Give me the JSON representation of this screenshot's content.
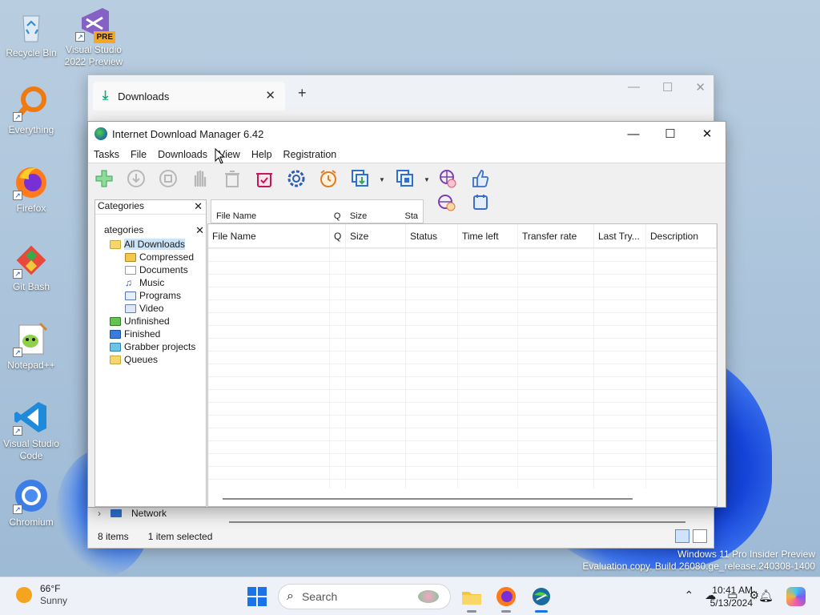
{
  "desktop": {
    "icons": [
      {
        "label": "Recycle Bin",
        "icon": "recycle-bin-icon"
      },
      {
        "label": "Visual Studio 2022 Preview",
        "badge": "PRE",
        "icon": "visual-studio-icon"
      },
      {
        "label": "Everything",
        "icon": "everything-search-icon"
      },
      {
        "label": "Firefox",
        "icon": "firefox-icon"
      },
      {
        "label": "Git Bash",
        "icon": "git-bash-icon"
      },
      {
        "label": "Notepad++",
        "icon": "notepad-plus-plus-icon"
      },
      {
        "label": "Visual Studio Code",
        "icon": "vscode-icon"
      },
      {
        "label": "Chromium",
        "icon": "chromium-icon"
      }
    ]
  },
  "back_window": {
    "tab_title": "Downloads",
    "tab_close": "✕",
    "new_tab": "+",
    "network_label": "Network",
    "status_items": "8 items",
    "status_selected": "1 item selected"
  },
  "idm": {
    "title": "Internet Download Manager 6.42",
    "menu": [
      "Tasks",
      "File",
      "Downloads",
      "View",
      "Help",
      "Registration"
    ],
    "controls": {
      "minimize": "—",
      "maximize": "☐",
      "close": "✕"
    },
    "ghost_header": [
      "File Name",
      "Q",
      "Size",
      "Sta"
    ],
    "categories_title_ghost": "Categories",
    "categories_title": "ategories",
    "categories_close": "✕",
    "tree": [
      {
        "label": "All Downloads",
        "level": 0,
        "selected": true,
        "icon": "folder-open-icon"
      },
      {
        "label": "Compressed",
        "level": 1,
        "icon": "zip-folder-icon"
      },
      {
        "label": "Documents",
        "level": 1,
        "icon": "document-icon"
      },
      {
        "label": "Music",
        "level": 1,
        "icon": "music-icon"
      },
      {
        "label": "Programs",
        "level": 1,
        "icon": "program-icon"
      },
      {
        "label": "Video",
        "level": 1,
        "icon": "video-icon"
      },
      {
        "label": "Unfinished",
        "level": 0,
        "icon": "unfinished-folder-icon"
      },
      {
        "label": "Finished",
        "level": 0,
        "icon": "finished-folder-icon"
      },
      {
        "label": "Grabber projects",
        "level": 0,
        "icon": "grabber-folder-icon"
      },
      {
        "label": "Queues",
        "level": 0,
        "icon": "queues-folder-icon"
      }
    ],
    "columns": [
      "File Name",
      "Q",
      "Size",
      "Status",
      "Time left",
      "Transfer rate",
      "Last Try...",
      "Description"
    ],
    "toolbar": [
      "add-url-icon",
      "resume-icon",
      "stop-icon",
      "stop-all-icon",
      "delete-icon",
      "delete-completed-icon",
      "options-icon",
      "scheduler-icon",
      "start-queue-icon",
      "stop-queue-icon",
      "grabber-icon",
      "tell-a-friend-icon",
      "site-grabber-icon",
      "tutorial-icon"
    ]
  },
  "watermark": {
    "line1": "Windows 11 Pro Insider Preview",
    "line2": "Evaluation copy. Build 26080.ge_release.240308-1400"
  },
  "taskbar": {
    "weather_temp": "66°F",
    "weather_desc": "Sunny",
    "search_placeholder": "Search",
    "time": "10:41 AM",
    "date": "5/13/2024"
  }
}
